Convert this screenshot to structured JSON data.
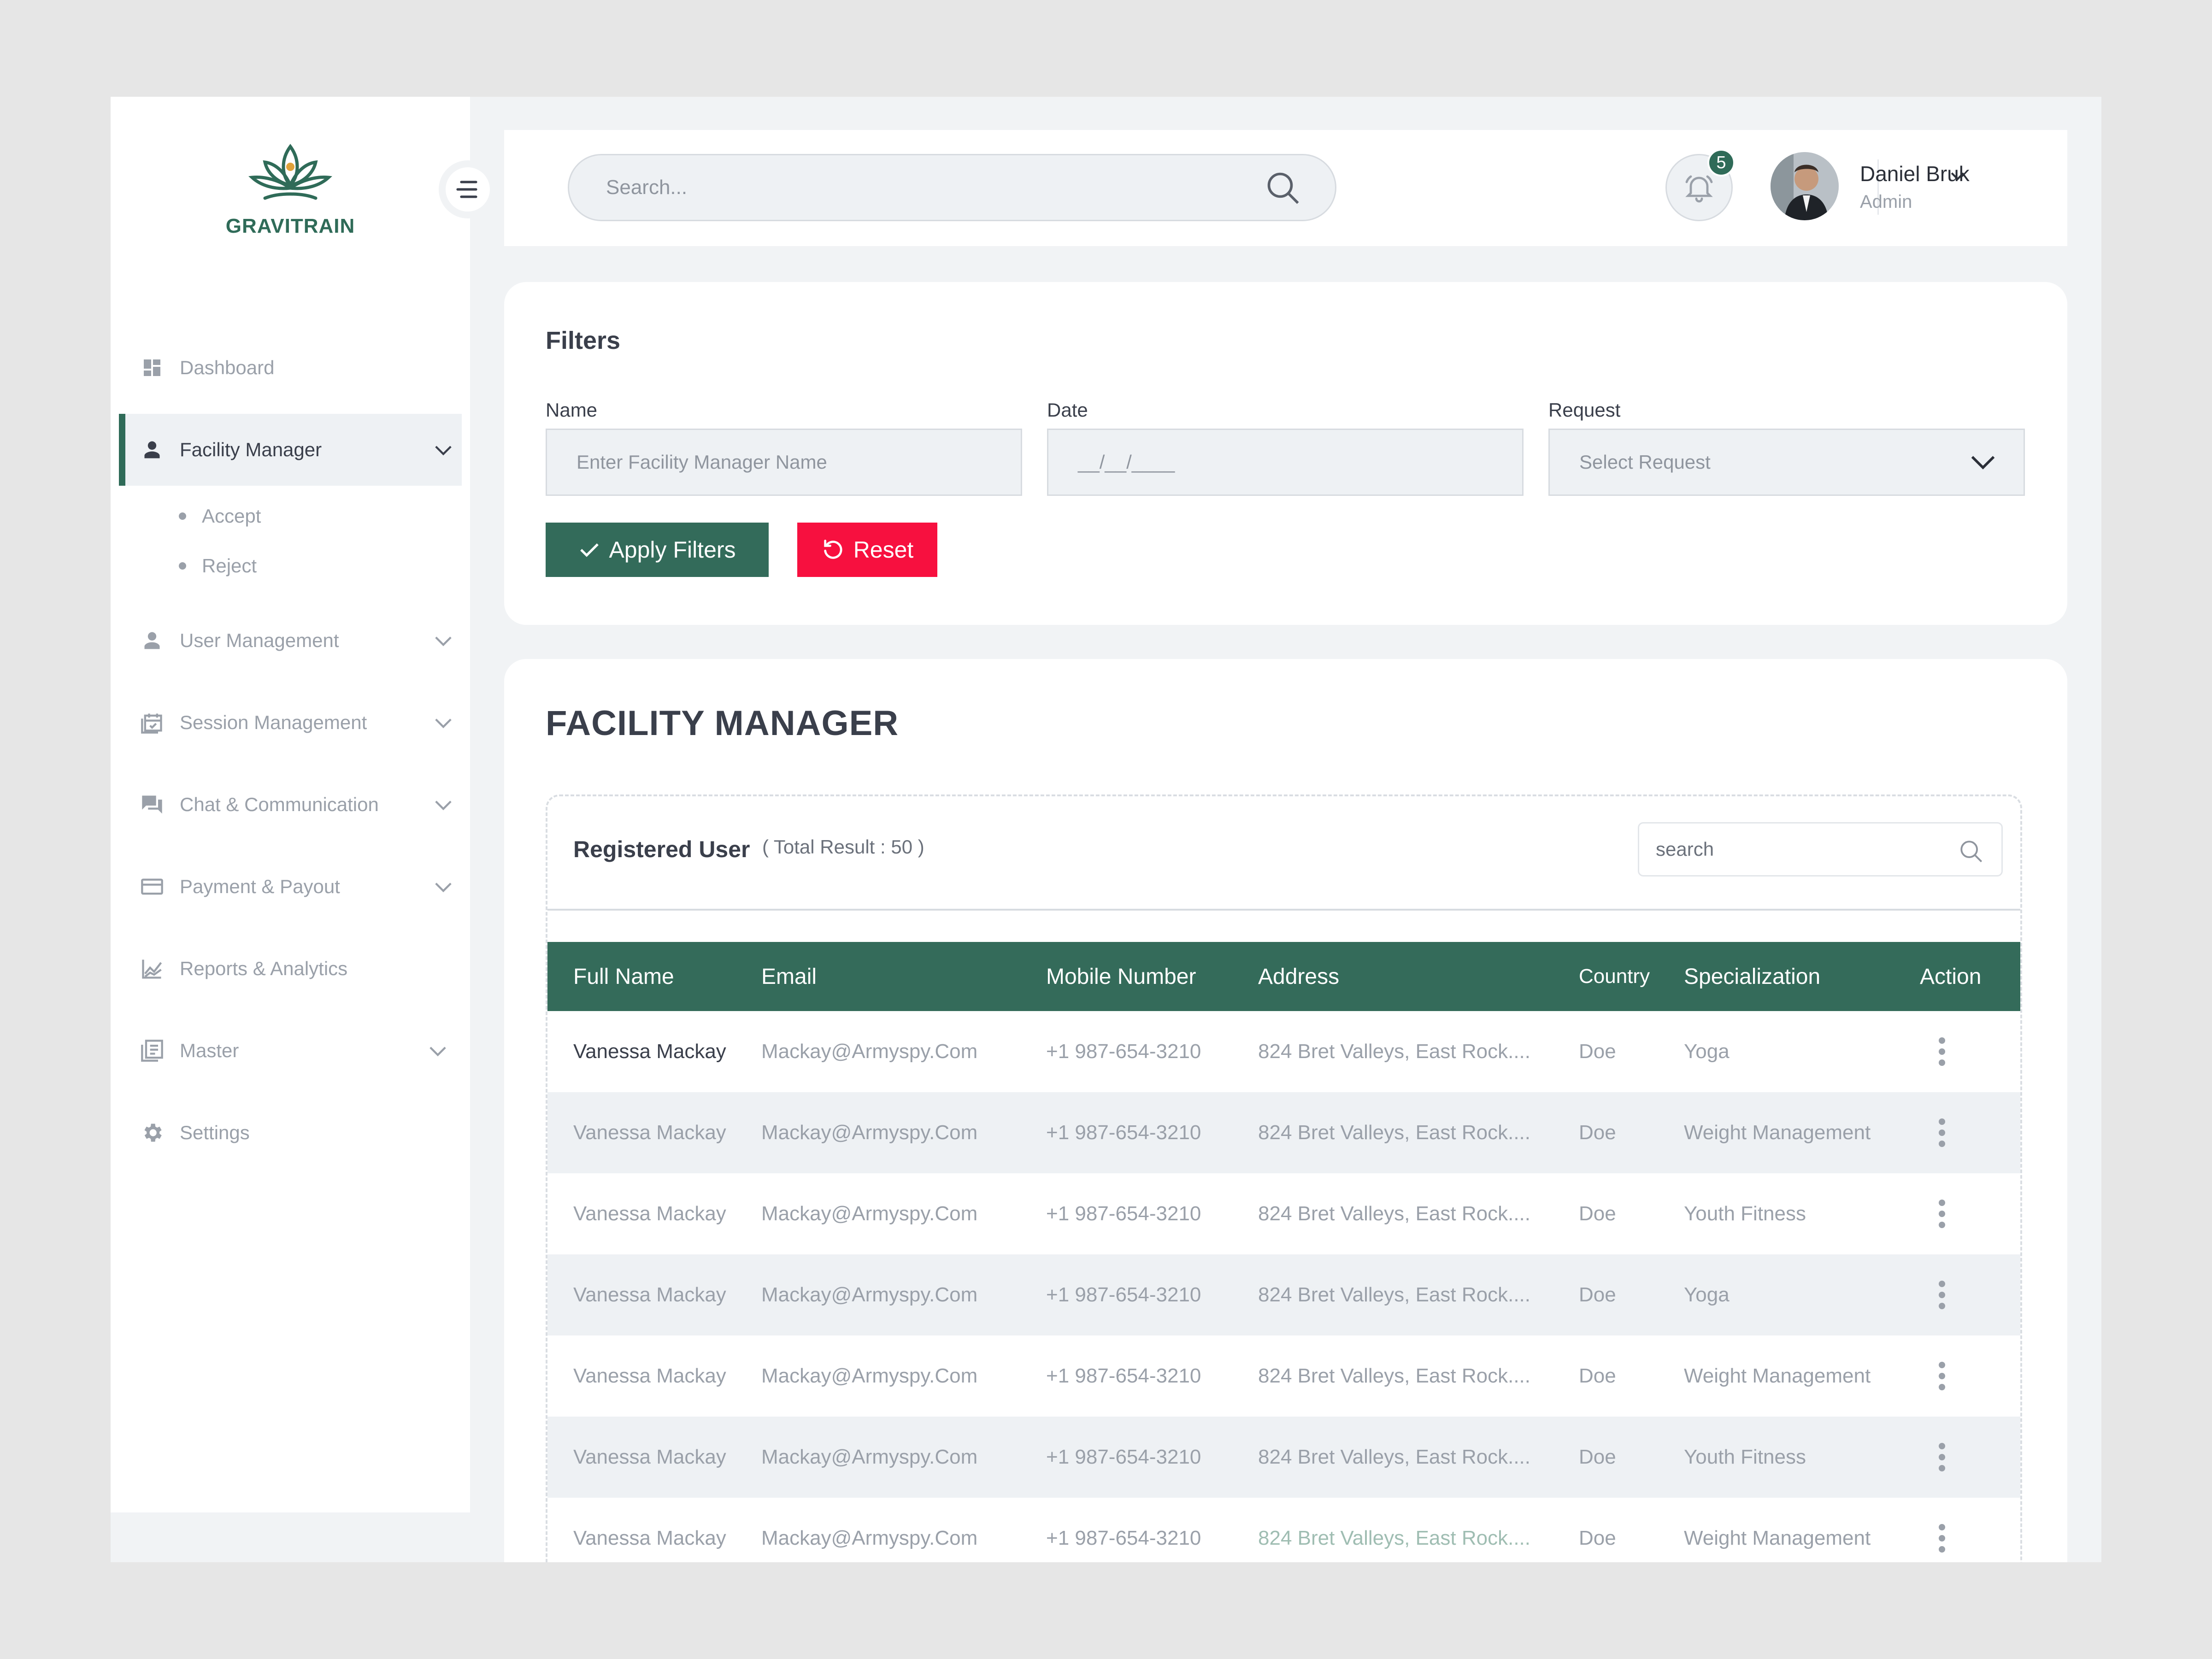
{
  "brand": {
    "name": "GRAVITRAIN",
    "color": "#2f6b58"
  },
  "colors": {
    "primary": "#336b5a",
    "danger": "#f7103f",
    "muted": "#9aa0a9"
  },
  "sidebar": {
    "items": [
      {
        "label": "Dashboard",
        "icon": "dashboard-icon"
      },
      {
        "label": "Facility Manager",
        "icon": "person-icon",
        "active": true,
        "sub": [
          {
            "label": "Accept"
          },
          {
            "label": "Reject"
          }
        ]
      },
      {
        "label": "User Management",
        "icon": "person-icon"
      },
      {
        "label": "Session Management",
        "icon": "calendar-icon"
      },
      {
        "label": "Chat & Communication",
        "icon": "chat-icon"
      },
      {
        "label": "Payment & Payout",
        "icon": "card-icon"
      },
      {
        "label": "Reports & Analytics",
        "icon": "chart-icon"
      },
      {
        "label": "Master",
        "icon": "book-icon"
      },
      {
        "label": "Settings",
        "icon": "gear-icon"
      }
    ]
  },
  "topbar": {
    "search_placeholder": "Search...",
    "notification_count": "5",
    "user": {
      "name": "Daniel Bruk",
      "role": "Admin"
    }
  },
  "filters": {
    "title": "Filters",
    "name_label": "Name",
    "name_placeholder": "Enter Facility Manager Name",
    "date_label": "Date",
    "date_placeholder": "__/__/____",
    "request_label": "Request",
    "request_placeholder": "Select Request",
    "apply_label": "Apply Filters",
    "reset_label": "Reset"
  },
  "table": {
    "title": "FACILITY MANAGER",
    "subtitle": "Registered User",
    "total": "( Total Result : 50 )",
    "search_placeholder": "search",
    "columns": [
      "Full Name",
      "Email",
      "Mobile Number",
      "Address",
      "Country",
      "Specialization",
      "Action"
    ],
    "rows": [
      [
        "Vanessa Mackay",
        "Mackay@Armyspy.Com",
        "+1 987-654-3210",
        "824 Bret Valleys, East Rock....",
        "Doe",
        "Yoga"
      ],
      [
        "Vanessa Mackay",
        "Mackay@Armyspy.Com",
        "+1 987-654-3210",
        "824 Bret Valleys, East Rock....",
        "Doe",
        "Weight Management"
      ],
      [
        "Vanessa Mackay",
        "Mackay@Armyspy.Com",
        "+1 987-654-3210",
        "824 Bret Valleys, East Rock....",
        "Doe",
        "Youth Fitness"
      ],
      [
        "Vanessa Mackay",
        "Mackay@Armyspy.Com",
        "+1 987-654-3210",
        "824 Bret Valleys, East Rock....",
        "Doe",
        "Yoga"
      ],
      [
        "Vanessa Mackay",
        "Mackay@Armyspy.Com",
        "+1 987-654-3210",
        "824 Bret Valleys, East Rock....",
        "Doe",
        "Weight Management"
      ],
      [
        "Vanessa Mackay",
        "Mackay@Armyspy.Com",
        "+1 987-654-3210",
        "824 Bret Valleys, East Rock....",
        "Doe",
        "Youth Fitness"
      ],
      [
        "Vanessa Mackay",
        "Mackay@Armyspy.Com",
        "+1 987-654-3210",
        "824 Bret Valleys, East Rock....",
        "Doe",
        "Weight Management"
      ]
    ]
  }
}
